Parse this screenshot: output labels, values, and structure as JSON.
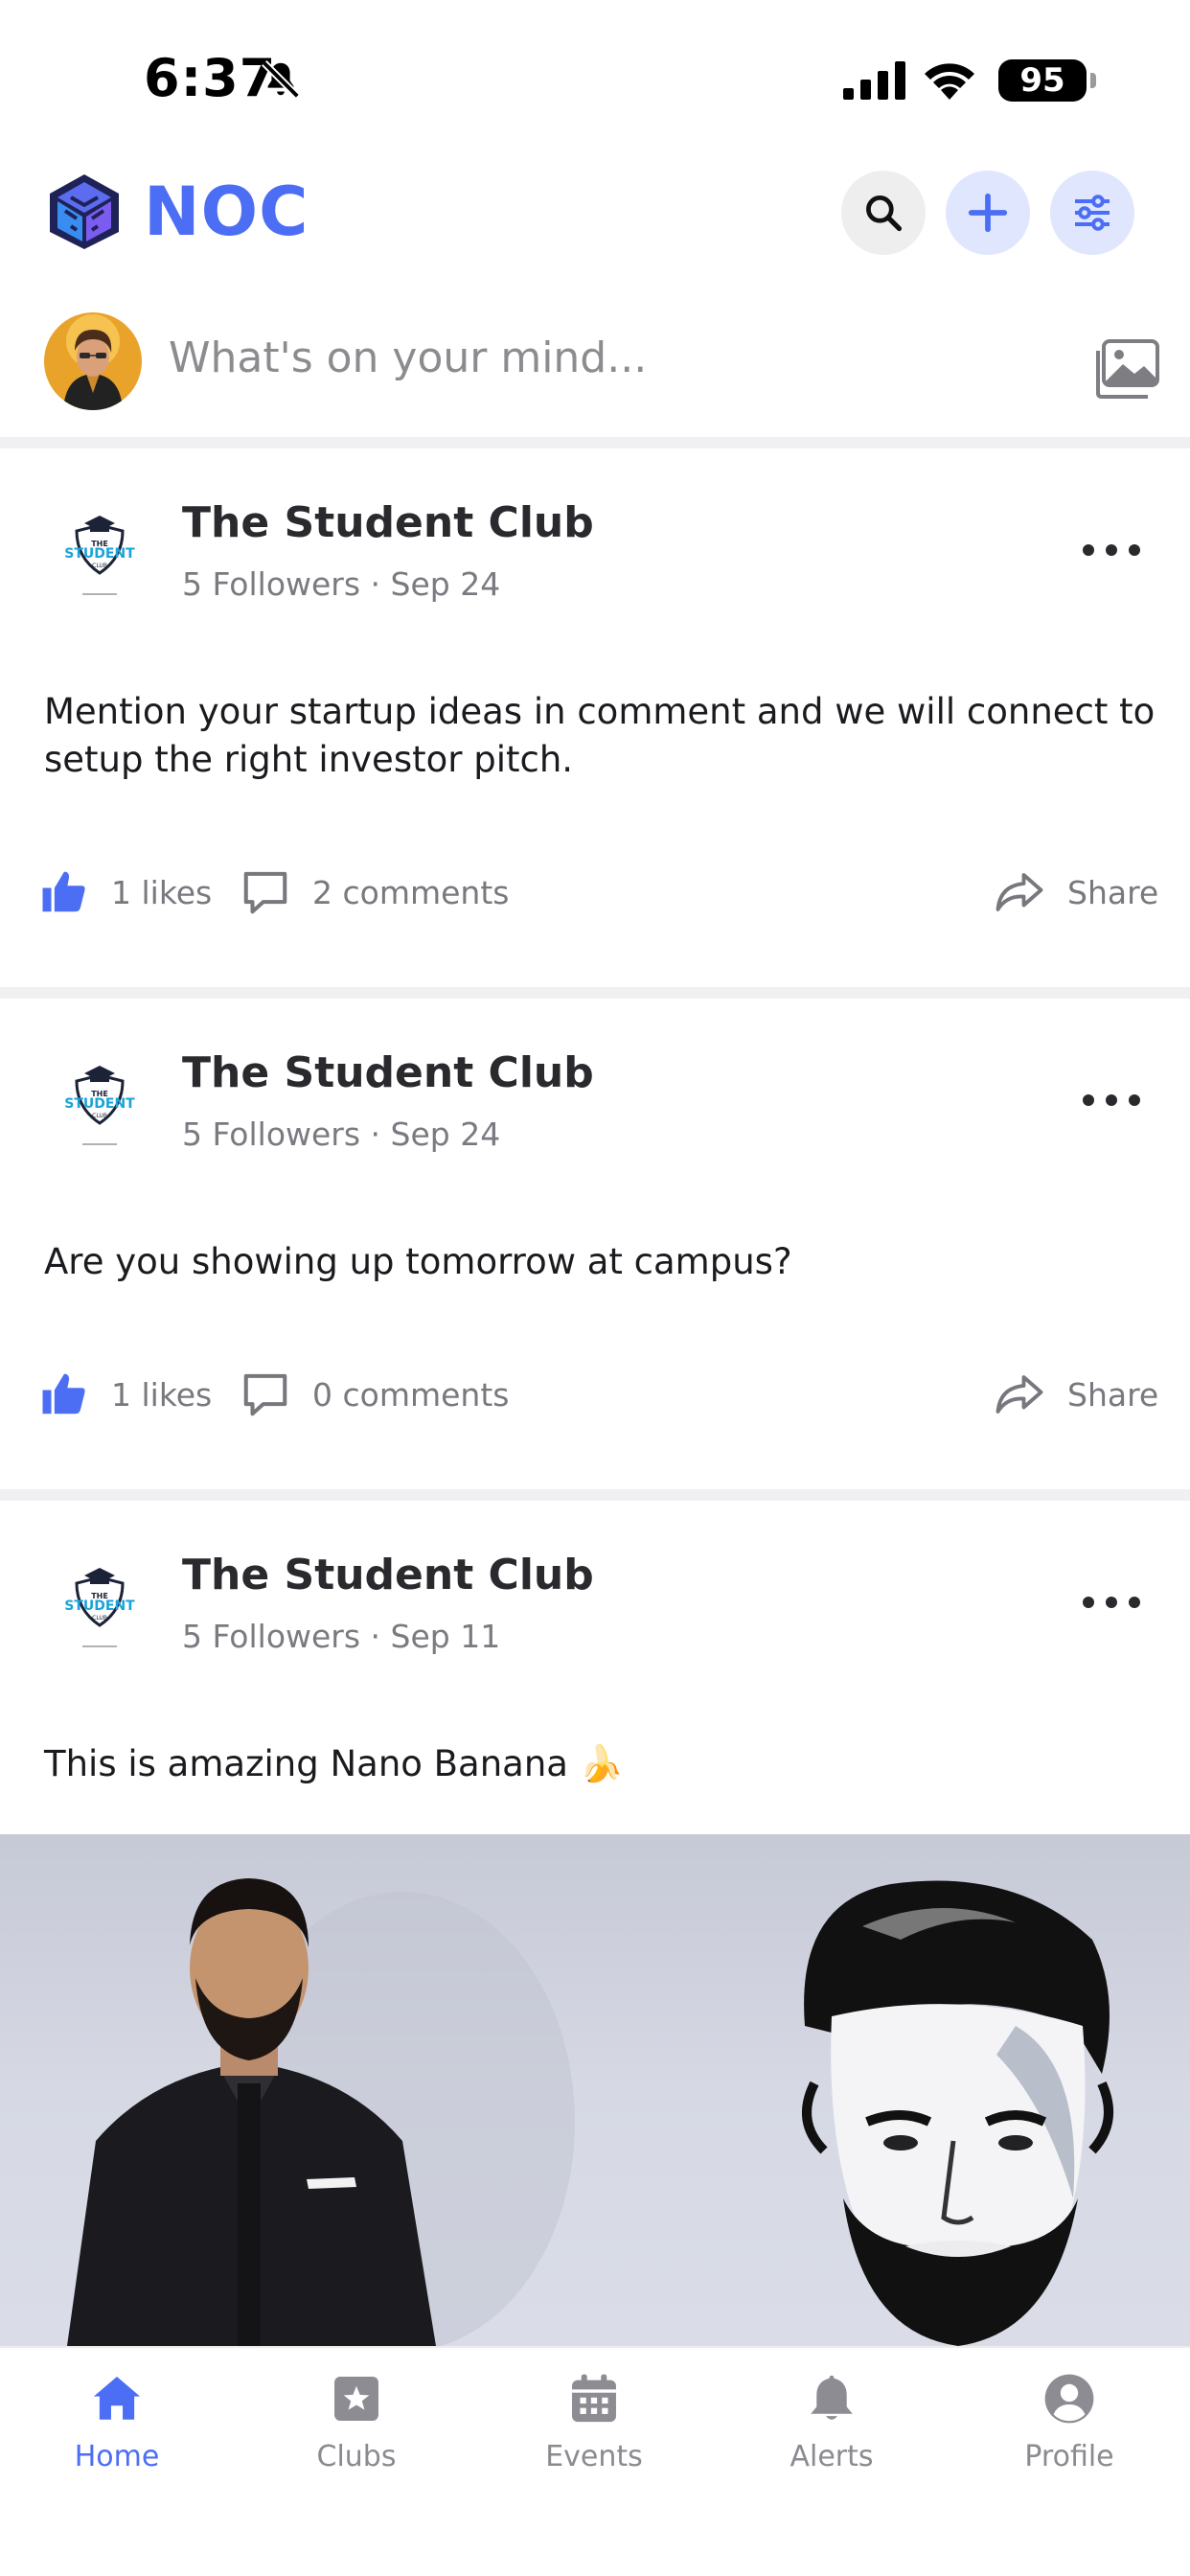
{
  "status_bar": {
    "time": "6:37",
    "battery": "95"
  },
  "header": {
    "title": "NOC"
  },
  "composer": {
    "placeholder": "What's on your mind..."
  },
  "posts": [
    {
      "club_name": "The Student Club",
      "followers": "5 Followers",
      "date": "Sep 24",
      "text": "Mention your startup ideas in comment and we will connect to setup the right investor pitch.",
      "likes": "1 likes",
      "comments": "2 comments",
      "share": "Share"
    },
    {
      "club_name": "The Student Club",
      "followers": "5 Followers",
      "date": "Sep 24",
      "text": "Are you showing up tomorrow at campus?",
      "likes": "1 likes",
      "comments": "0 comments",
      "share": "Share"
    },
    {
      "club_name": "The Student Club",
      "followers": "5 Followers",
      "date": "Sep 11",
      "text": "This is amazing Nano Banana 🍌",
      "has_image": true
    }
  ],
  "bottom_nav": [
    {
      "label": "Home",
      "icon": "home-icon",
      "active": true
    },
    {
      "label": "Clubs",
      "icon": "clubs-icon",
      "active": false
    },
    {
      "label": "Events",
      "icon": "calendar-icon",
      "active": false
    },
    {
      "label": "Alerts",
      "icon": "bell-icon",
      "active": false
    },
    {
      "label": "Profile",
      "icon": "profile-icon",
      "active": false
    }
  ],
  "colors": {
    "accent": "#4c6ef5",
    "like": "#4c6ef5",
    "divider": "#f0f0f2"
  }
}
